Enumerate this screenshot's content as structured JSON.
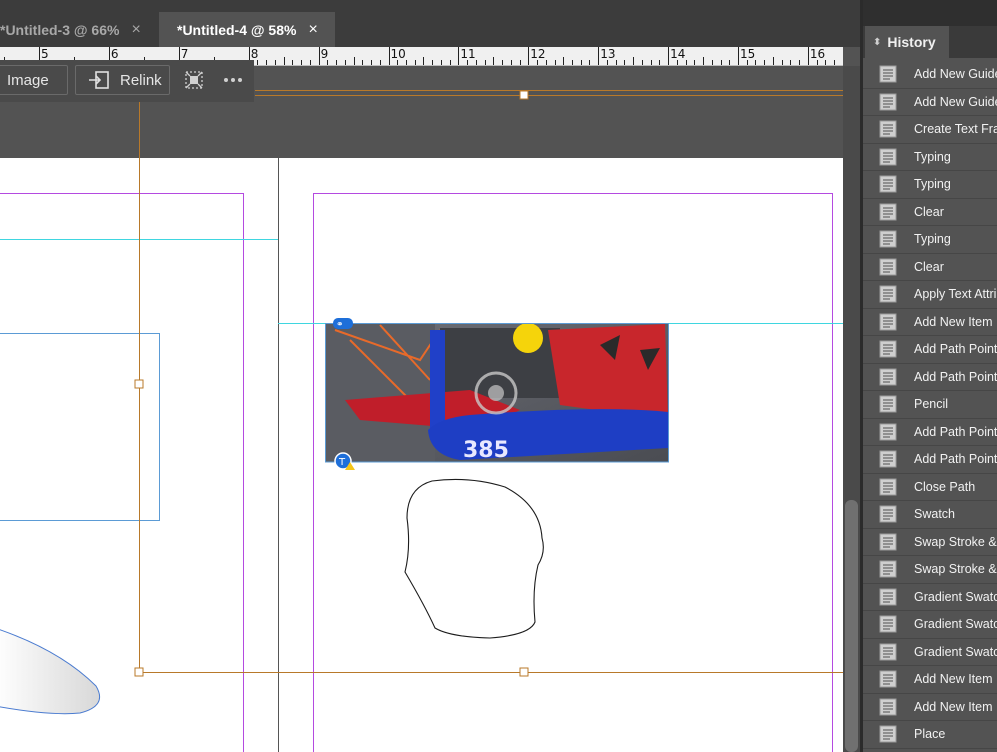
{
  "tabs": [
    {
      "label": "*Untitled-3 @ 66%",
      "close": "×",
      "active": false
    },
    {
      "label": "*Untitled-4 @ 58%",
      "close": "×",
      "active": true
    }
  ],
  "ruler": {
    "numbers": [
      "5",
      "6",
      "7",
      "8",
      "9",
      "10",
      "11",
      "12",
      "13",
      "14",
      "15",
      "16"
    ]
  },
  "context_bar": {
    "image_button": "Image",
    "relink_button": "Relink",
    "more_icon": "ellipsis-icon",
    "frame_icon": "fit-frame-icon"
  },
  "image": {
    "number_text": "385"
  },
  "history": {
    "title": "History",
    "items": [
      "Add New Guide",
      "Add New Guide",
      "Create Text Frame",
      "Typing",
      "Typing",
      "Clear",
      "Typing",
      "Clear",
      "Apply Text Attributes",
      "Add New Item",
      "Add Path Points",
      "Add Path Points",
      "Pencil",
      "Add Path Points",
      "Add Path Points",
      "Close Path",
      "Swatch",
      "Swap Stroke & Fill",
      "Swap Stroke & Fill",
      "Gradient Swatch",
      "Gradient Swatch",
      "Gradient Swatch",
      "Add New Item",
      "Add New Item",
      "Place"
    ]
  },
  "colors": {
    "ui_dark": "#3c3c3c",
    "ui_mid": "#535353",
    "guide_orange": "#b8792a",
    "margin_purple": "#b44ae0",
    "guide_cyan": "#3fd6e0",
    "frame_blue": "#5b9bd5"
  }
}
